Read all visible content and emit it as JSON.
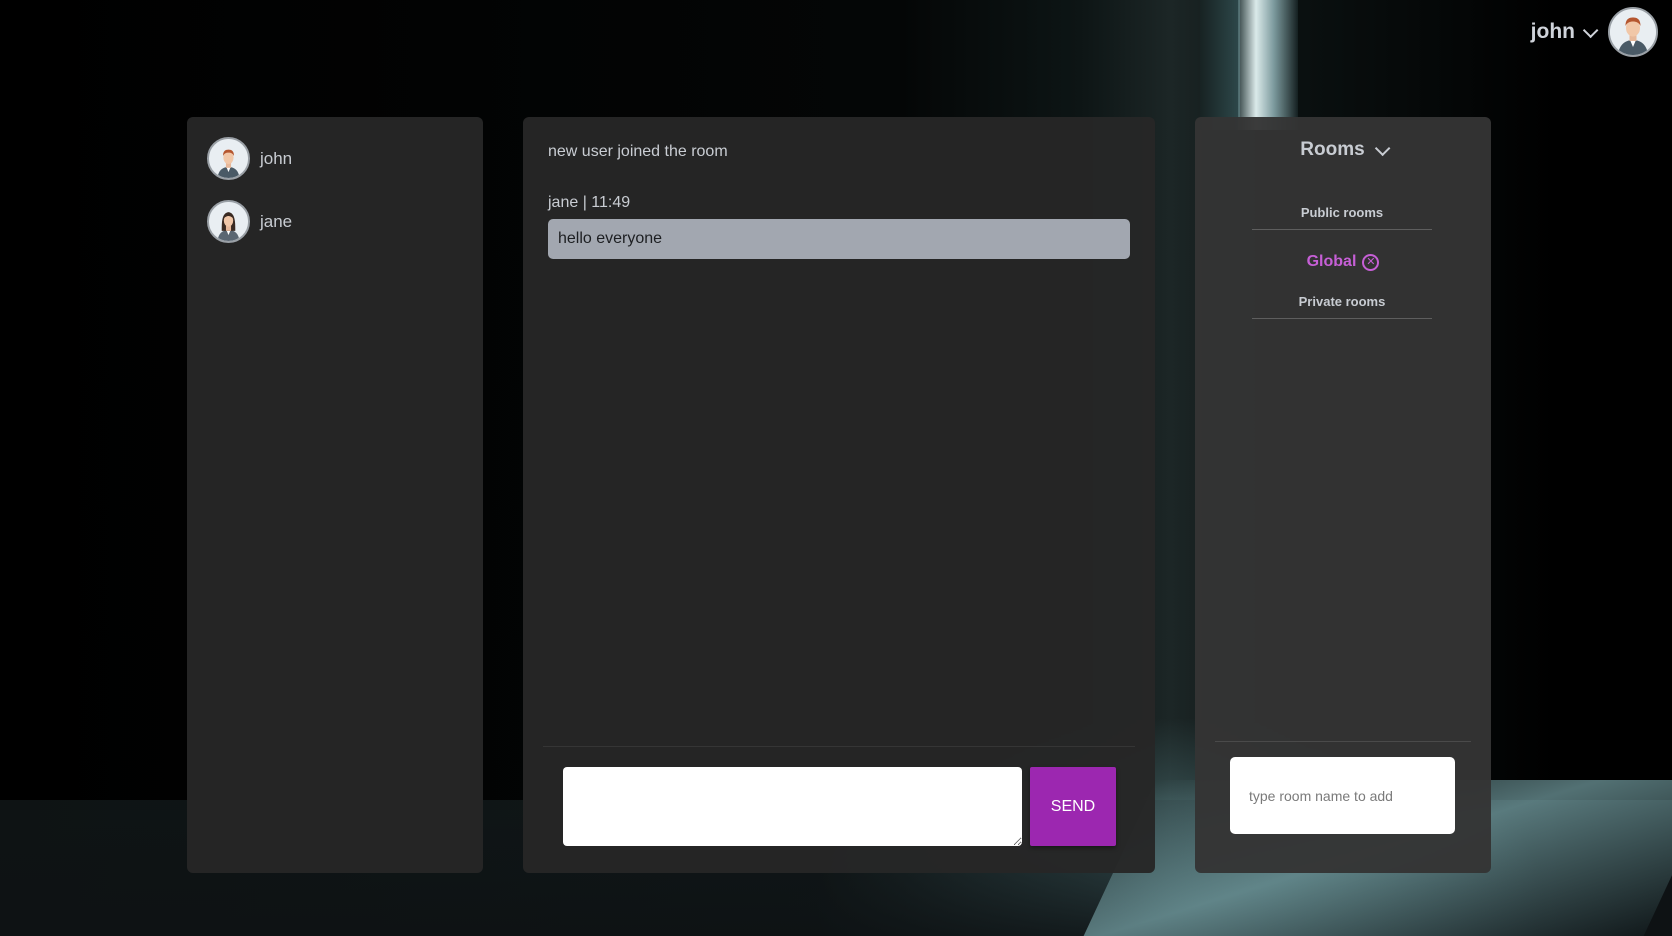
{
  "header": {
    "username": "john",
    "avatar_icon": "male-avatar-icon",
    "dropdown_icon": "chevron-down-icon"
  },
  "users": [
    {
      "name": "john",
      "avatar_icon": "male-avatar-icon"
    },
    {
      "name": "jane",
      "avatar_icon": "female-avatar-icon"
    }
  ],
  "chat": {
    "system_message": "new user joined the room",
    "messages": [
      {
        "meta": "jane | 11:49",
        "text": "hello everyone"
      }
    ],
    "input_value": "",
    "send_label": "SEND",
    "send_color": "#9c27b0"
  },
  "rooms": {
    "title": "Rooms",
    "public_label": "Public rooms",
    "public_rooms": [
      {
        "name": "Global",
        "active_color": "#c65fd6",
        "remove_icon": "close-circle-icon"
      }
    ],
    "private_label": "Private rooms",
    "add_placeholder": "type room name to add"
  }
}
